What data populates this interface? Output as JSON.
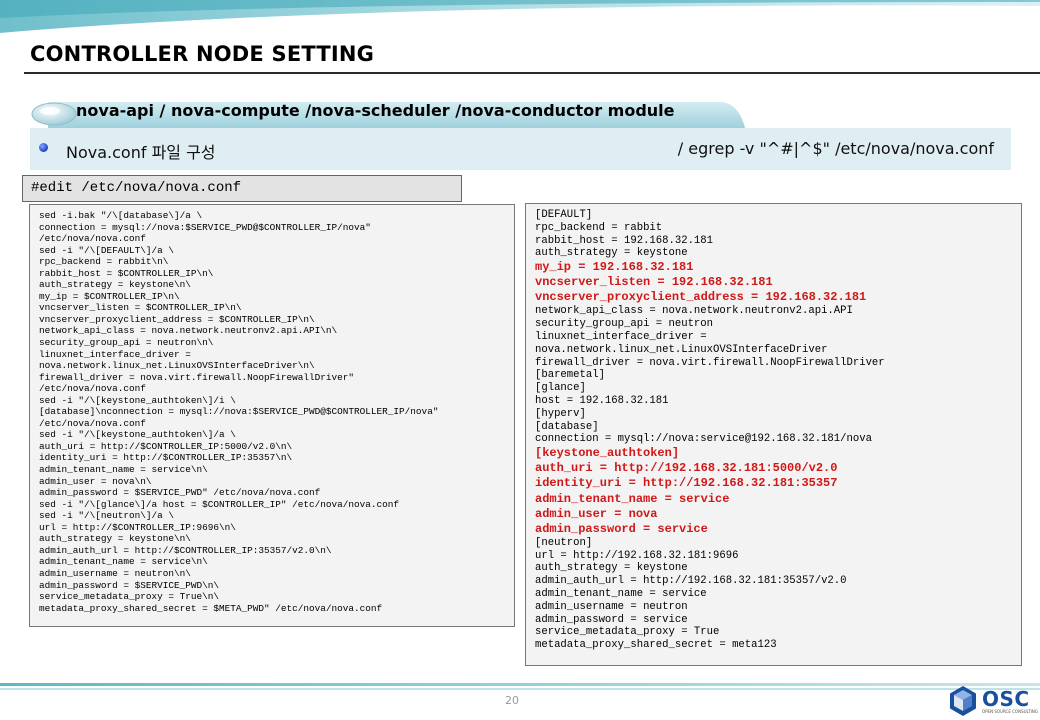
{
  "slide": {
    "title": "CONTROLLER NODE SETTING",
    "section_label": "nova-api / nova-compute /nova-scheduler /nova-conductor module",
    "subtitle_left": "Nova.conf 파일 구성",
    "subtitle_right": "/ egrep -v \"^#|^$\" /etc/nova/nova.conf",
    "edit_command": "#edit /etc/nova/nova.conf",
    "page_number": "20"
  },
  "colors": {
    "accent_teal": "#5fb8c6",
    "sub_bar": "#dfeef2",
    "highlight_red": "#d01818",
    "logo_blue": "#1a4f9e"
  },
  "left_code": {
    "lines": [
      "sed -i.bak \"/\\[database\\]/a \\",
      "connection = mysql://nova:$SERVICE_PWD@$CONTROLLER_IP/nova\"",
      "/etc/nova/nova.conf",
      "sed -i \"/\\[DEFAULT\\]/a \\",
      "rpc_backend = rabbit\\n\\",
      "rabbit_host = $CONTROLLER_IP\\n\\",
      "auth_strategy = keystone\\n\\",
      "my_ip = $CONTROLLER_IP\\n\\",
      "vncserver_listen = $CONTROLLER_IP\\n\\",
      "vncserver_proxyclient_address = $CONTROLLER_IP\\n\\",
      "network_api_class = nova.network.neutronv2.api.API\\n\\",
      "security_group_api = neutron\\n\\",
      "linuxnet_interface_driver =",
      "nova.network.linux_net.LinuxOVSInterfaceDriver\\n\\",
      "firewall_driver = nova.virt.firewall.NoopFirewallDriver\"",
      "/etc/nova/nova.conf",
      "sed -i \"/\\[keystone_authtoken\\]/i \\",
      "[database]\\nconnection = mysql://nova:$SERVICE_PWD@$CONTROLLER_IP/nova\"",
      "/etc/nova/nova.conf",
      "sed -i \"/\\[keystone_authtoken\\]/a \\",
      "auth_uri = http://$CONTROLLER_IP:5000/v2.0\\n\\",
      "identity_uri = http://$CONTROLLER_IP:35357\\n\\",
      "admin_tenant_name = service\\n\\",
      "admin_user = nova\\n\\",
      "admin_password = $SERVICE_PWD\" /etc/nova/nova.conf",
      "sed -i \"/\\[glance\\]/a host = $CONTROLLER_IP\" /etc/nova/nova.conf",
      "sed -i \"/\\[neutron\\]/a \\",
      "url = http://$CONTROLLER_IP:9696\\n\\",
      "auth_strategy = keystone\\n\\",
      "admin_auth_url = http://$CONTROLLER_IP:35357/v2.0\\n\\",
      "admin_tenant_name = service\\n\\",
      "admin_username = neutron\\n\\",
      "admin_password = $SERVICE_PWD\\n\\",
      "service_metadata_proxy = True\\n\\",
      "metadata_proxy_shared_secret = $META_PWD\" /etc/nova/nova.conf"
    ]
  },
  "right_code": {
    "lines": [
      {
        "text": "[DEFAULT]",
        "highlight": false
      },
      {
        "text": "rpc_backend = rabbit",
        "highlight": false
      },
      {
        "text": "rabbit_host = 192.168.32.181",
        "highlight": false
      },
      {
        "text": "auth_strategy = keystone",
        "highlight": false
      },
      {
        "text": "my_ip = 192.168.32.181",
        "highlight": true
      },
      {
        "text": "vncserver_listen = 192.168.32.181",
        "highlight": true
      },
      {
        "text": "vncserver_proxyclient_address = 192.168.32.181",
        "highlight": true
      },
      {
        "text": "network_api_class = nova.network.neutronv2.api.API",
        "highlight": false
      },
      {
        "text": "security_group_api = neutron",
        "highlight": false
      },
      {
        "text": "linuxnet_interface_driver =",
        "highlight": false
      },
      {
        "text": "nova.network.linux_net.LinuxOVSInterfaceDriver",
        "highlight": false
      },
      {
        "text": "firewall_driver = nova.virt.firewall.NoopFirewallDriver",
        "highlight": false
      },
      {
        "text": "[baremetal]",
        "highlight": false
      },
      {
        "text": "[glance]",
        "highlight": false
      },
      {
        "text": "host = 192.168.32.181",
        "highlight": false
      },
      {
        "text": "[hyperv]",
        "highlight": false
      },
      {
        "text": "[database]",
        "highlight": false
      },
      {
        "text": "connection = mysql://nova:service@192.168.32.181/nova",
        "highlight": false
      },
      {
        "text": "[keystone_authtoken]",
        "highlight": true
      },
      {
        "text": "auth_uri = http://192.168.32.181:5000/v2.0",
        "highlight": true
      },
      {
        "text": "identity_uri = http://192.168.32.181:35357",
        "highlight": true
      },
      {
        "text": "admin_tenant_name = service",
        "highlight": true
      },
      {
        "text": "admin_user = nova",
        "highlight": true
      },
      {
        "text": "admin_password = service",
        "highlight": true
      },
      {
        "text": "[neutron]",
        "highlight": false
      },
      {
        "text": "url = http://192.168.32.181:9696",
        "highlight": false
      },
      {
        "text": "auth_strategy = keystone",
        "highlight": false
      },
      {
        "text": "admin_auth_url = http://192.168.32.181:35357/v2.0",
        "highlight": false
      },
      {
        "text": "admin_tenant_name = service",
        "highlight": false
      },
      {
        "text": "admin_username = neutron",
        "highlight": false
      },
      {
        "text": "admin_password = service",
        "highlight": false
      },
      {
        "text": "service_metadata_proxy = True",
        "highlight": false
      },
      {
        "text": "metadata_proxy_shared_secret = meta123",
        "highlight": false
      }
    ]
  },
  "logo": {
    "brand_text": "OSC",
    "tagline": "OPEN SOURCE CONSULTING",
    "icon": "hexagon-cube-icon"
  }
}
